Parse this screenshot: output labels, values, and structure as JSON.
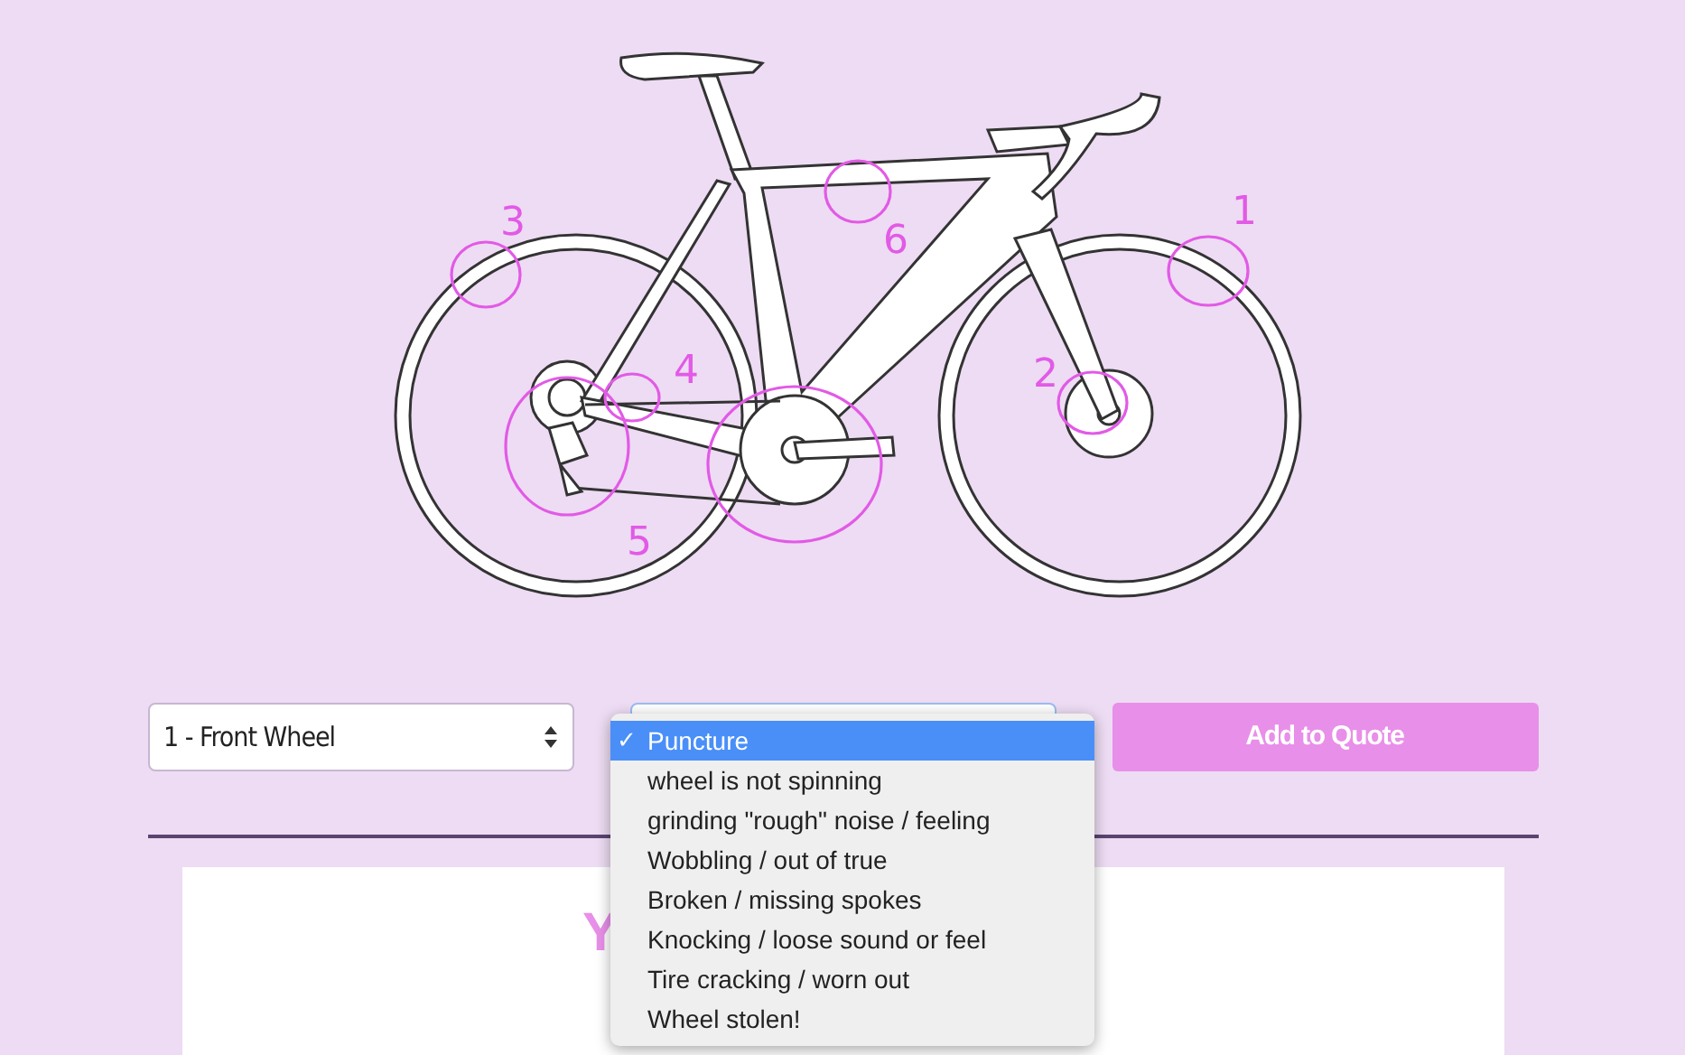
{
  "illustration": {
    "markers": [
      {
        "label": "1"
      },
      {
        "label": "2"
      },
      {
        "label": "3"
      },
      {
        "label": "4"
      },
      {
        "label": "5"
      },
      {
        "label": "6"
      }
    ]
  },
  "part_select": {
    "value": "1 - Front Wheel"
  },
  "problem_select": {
    "expanded": true,
    "check_mark": "✓",
    "options": [
      {
        "label": "Puncture",
        "selected": true
      },
      {
        "label": "wheel is not spinning",
        "selected": false
      },
      {
        "label": "grinding \"rough\" noise / feeling",
        "selected": false
      },
      {
        "label": "Wobbling / out of true",
        "selected": false
      },
      {
        "label": "Broken / missing spokes",
        "selected": false
      },
      {
        "label": "Knocking / loose sound or feel",
        "selected": false
      },
      {
        "label": "Tire cracking / worn out",
        "selected": false
      },
      {
        "label": "Wheel stolen!",
        "selected": false
      }
    ]
  },
  "add_button": {
    "label": "Add to Quote"
  },
  "quote_panel": {
    "heading": "Y"
  }
}
